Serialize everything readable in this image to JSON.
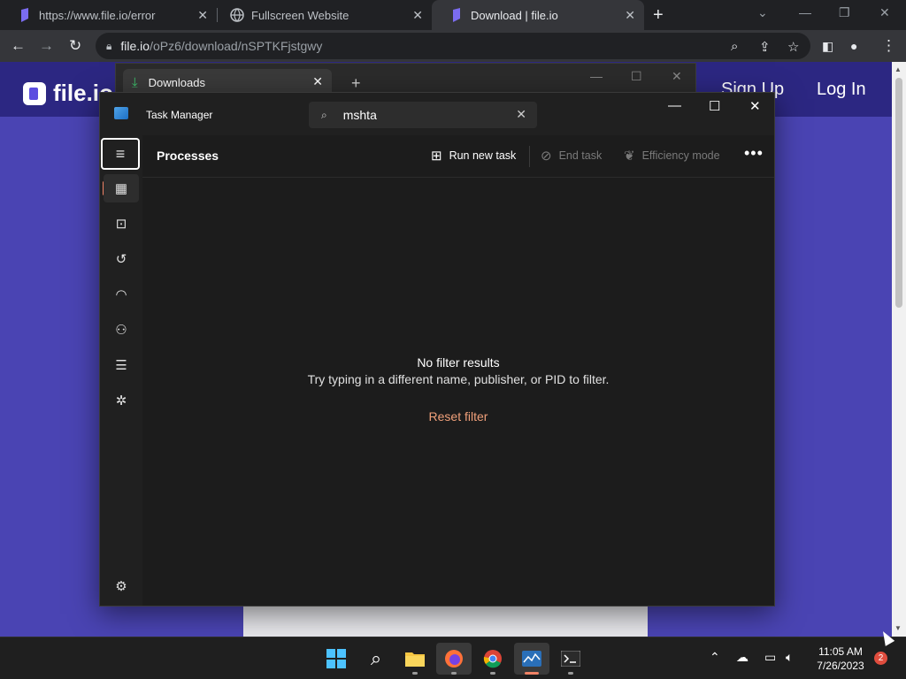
{
  "browser": {
    "tabs": [
      {
        "label": "https://www.file.io/error",
        "icon": "fileio-icon"
      },
      {
        "label": "Fullscreen Website",
        "icon": "globe-icon"
      },
      {
        "label": "Download | file.io",
        "icon": "fileio-icon"
      }
    ],
    "active_tab": 2,
    "url_host": "file.io",
    "url_path": "/oPz6/download/nSPTKFjstgwy"
  },
  "site": {
    "logo_text": "file.io",
    "signup": "Sign Up",
    "login": "Log In"
  },
  "downloads": {
    "tab_label": "Downloads"
  },
  "task_manager": {
    "title": "Task Manager",
    "search_value": "mshta",
    "page_title": "Processes",
    "commands": {
      "run_new_task": "Run new task",
      "end_task": "End task",
      "efficiency_mode": "Efficiency mode"
    },
    "empty_title": "No filter results",
    "empty_subtitle": "Try typing in a different name, publisher, or PID to filter.",
    "reset_filter": "Reset filter"
  },
  "taskbar": {
    "time": "11:05 AM",
    "date": "7/26/2023",
    "notification_count": "2"
  },
  "colors": {
    "site_bg": "#4a44b3",
    "site_header": "#2c2782",
    "accent": "#f08366",
    "reset_link": "#f0a07a"
  }
}
